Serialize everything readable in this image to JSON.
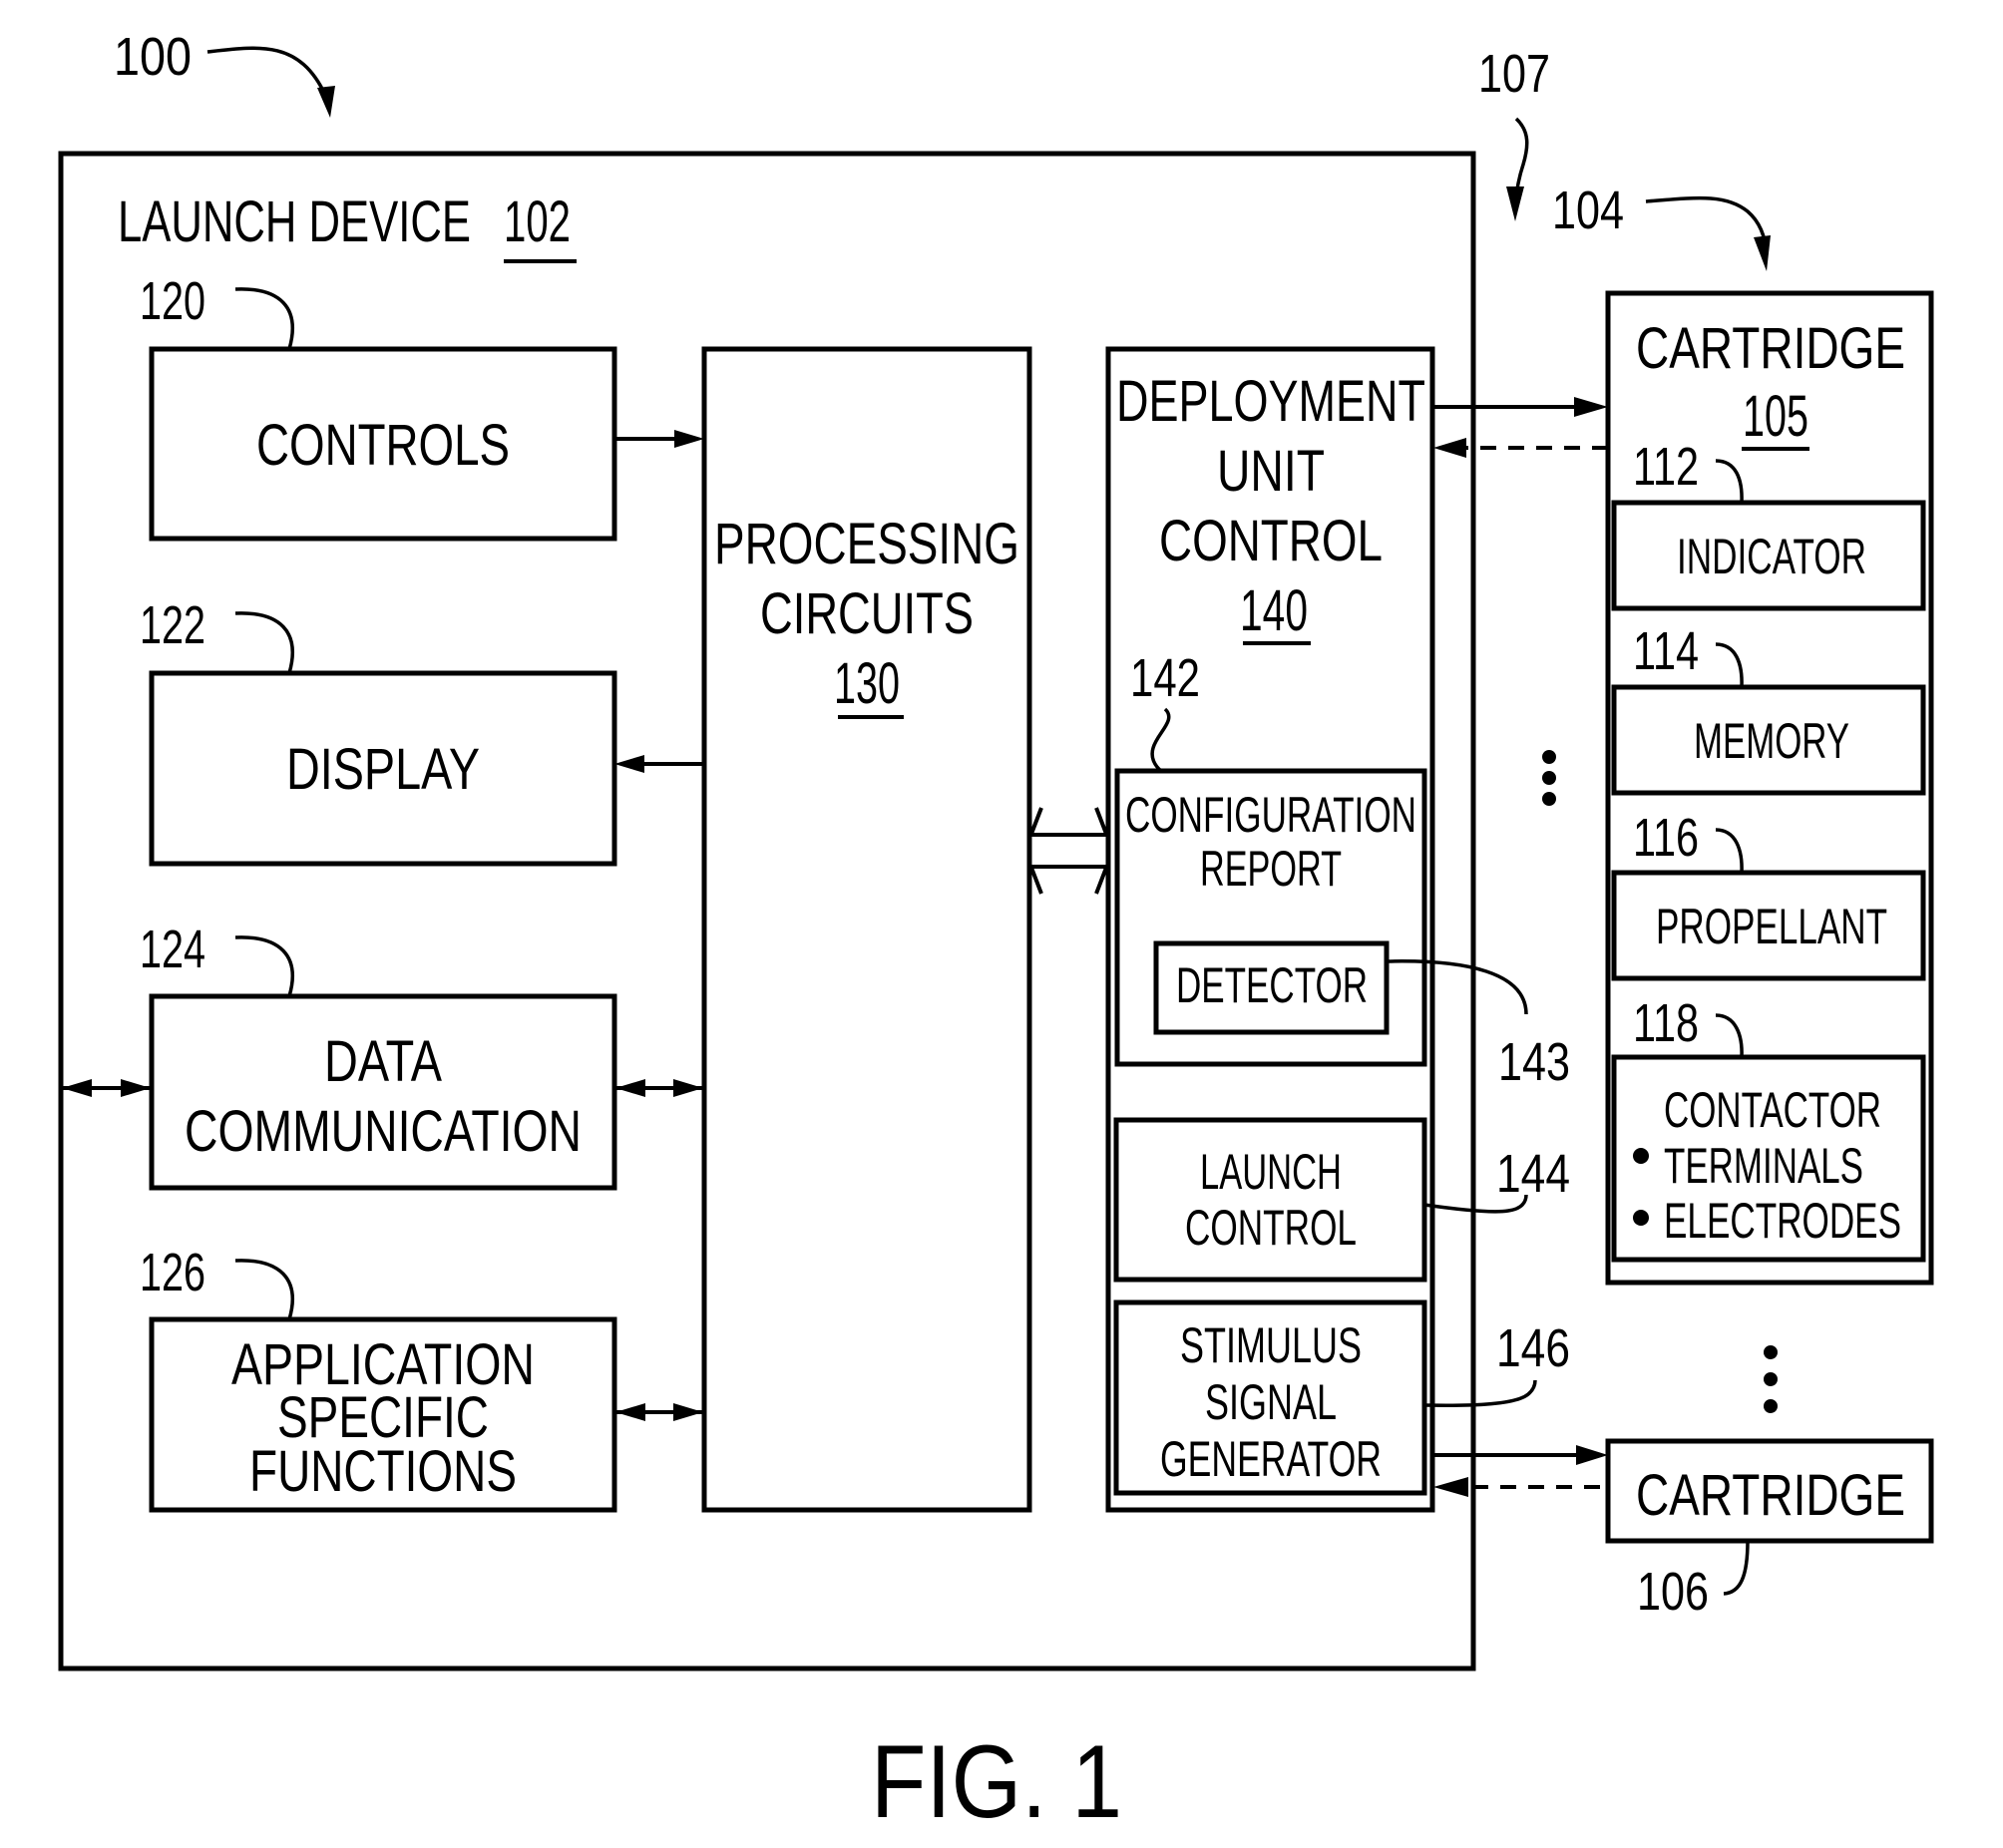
{
  "figure": {
    "caption": "FIG. 1",
    "system_ref": "100",
    "launch_device": {
      "title": "LAUNCH DEVICE",
      "ref": "102"
    },
    "group_ref_107": "107",
    "group_ref_104": "104",
    "blocks": {
      "controls": {
        "label": "CONTROLS",
        "ref": "120"
      },
      "display": {
        "label": "DISPLAY",
        "ref": "122"
      },
      "data_communication": {
        "lines": [
          "DATA",
          "COMMUNICATION"
        ],
        "ref": "124"
      },
      "application_specific_functions": {
        "lines": [
          "APPLICATION",
          "SPECIFIC",
          "FUNCTIONS"
        ],
        "ref": "126"
      },
      "processing_circuits": {
        "lines": [
          "PROCESSING",
          "CIRCUITS"
        ],
        "ref": "130"
      },
      "deployment_unit_control": {
        "lines": [
          "DEPLOYMENT",
          "UNIT",
          "CONTROL"
        ],
        "ref": "140"
      },
      "configuration_report": {
        "lines": [
          "CONFIGURATION",
          "REPORT"
        ],
        "ref": "142"
      },
      "detector": {
        "label": "DETECTOR",
        "ref": "143"
      },
      "launch_control": {
        "lines": [
          "LAUNCH",
          "CONTROL"
        ],
        "ref": "144"
      },
      "stimulus_signal_generator": {
        "lines": [
          "STIMULUS",
          "SIGNAL",
          "GENERATOR"
        ],
        "ref": "146"
      }
    },
    "cartridge_105": {
      "title": "CARTRIDGE",
      "ref": "105",
      "components": {
        "indicator": {
          "label": "INDICATOR",
          "ref": "112"
        },
        "memory": {
          "label": "MEMORY",
          "ref": "114"
        },
        "propellant": {
          "label": "PROPELLANT",
          "ref": "116"
        },
        "contactor": {
          "title": "CONTACTOR",
          "bullets": [
            "TERMINALS",
            "ELECTRODES"
          ],
          "ref": "118"
        }
      }
    },
    "cartridge_106": {
      "title": "CARTRIDGE",
      "ref": "106"
    },
    "ellipsis": "⋮"
  }
}
